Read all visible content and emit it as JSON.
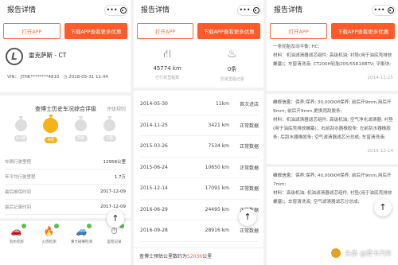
{
  "screen1": {
    "title": "报告详情",
    "menu_dots": "•••",
    "open_app": "打开APP",
    "download_app": "下载APP查看更多优惠",
    "car_name": "雷克萨斯 - CT",
    "vin": "VIN： JTHK********4810",
    "date": "2018-05-31 11:44",
    "grade_title": "查博士历史车况综合评级",
    "grade_link": "评级规则",
    "grades": [
      {
        "label": "A+级",
        "active": false
      },
      {
        "label": "A级",
        "active": true
      },
      {
        "label": "B级",
        "active": false
      },
      {
        "label": "C级",
        "active": false
      }
    ],
    "stats": [
      {
        "key": "车辆行驶里程",
        "value": "12958公里"
      },
      {
        "key": "年平均行驶里程",
        "value": "1.7万"
      },
      {
        "key": "最后维保时间",
        "value": "2017-12-09"
      },
      {
        "key": "最后记录时间",
        "value": "2017-12-09"
      }
    ],
    "icons": [
      {
        "label": "泡水检测",
        "glyph": "🚗"
      },
      {
        "label": "火烧检测",
        "glyph": "🔥"
      },
      {
        "label": "重大碰撞检测",
        "glyph": "🚙"
      },
      {
        "label": "里程记录",
        "glyph": "⏱"
      }
    ],
    "fab": "↑"
  },
  "screen2": {
    "title": "报告详情",
    "menu_dots": "•••",
    "open_app": "打开APP",
    "download_app": "下载APP查看更多优惠",
    "kpi_mileage": "45774 km",
    "kpi_mileage_label": "已行驶里程数",
    "kpi_count": "0条",
    "kpi_count_label": "异常里程记录",
    "records": [
      {
        "date": "2014-05-30",
        "km": "11km",
        "type": "首次进店"
      },
      {
        "date": "2014-11-25",
        "km": "3421 km",
        "type": "正常数据"
      },
      {
        "date": "2015-03-26",
        "km": "7534 km",
        "type": "正常数据"
      },
      {
        "date": "2015-06-24",
        "km": "10650 km",
        "type": "正常数据"
      },
      {
        "date": "2015-12-14",
        "km": "17091 km",
        "type": "正常数据"
      },
      {
        "date": "2016-06-29",
        "km": "24495 km",
        "type": "正常数据"
      },
      {
        "date": "2016-09-28",
        "km": "28916 km",
        "type": "正常数据"
      }
    ],
    "summary_prefix": "查博士预估公里数约为",
    "summary_value": "52036",
    "summary_suffix": "公里",
    "fab": "↑"
  },
  "screen3": {
    "title": "报告详情",
    "menu_dots": "•••",
    "open_app": "打开APP",
    "download_app": "下载APP查看更多优惠",
    "block1_text": "一条轮胎及动平衡; HC;",
    "block1_materials": "材料：机油滤清器滤芯组件; 高级机油; 衬垫(用于油底壳排放螺塞)；车窗清洗液; CT200H轮胎205/55R16BTV; 平衡块;",
    "block1_date": "2014-11-25",
    "block2_label": "维修信息：",
    "block2_text": "保养;保养; 30,000KM保养; 前后开9mm,用后开9mm; 前后开9mm,更换雨刮胶条;",
    "block2_materials": "材料：机油滤清器滤芯组件; 高级机油; 空气净化滤清器; 衬垫(用于油底壳排放螺塞)；右前刮水器橡胶条; 左前刮水器橡胶条; 后刮水器橡胶条; 空气滤清器滤芯分总成; 车窗清洗液;",
    "block2_date": "2015-12-14",
    "block3_label": "维修信息：",
    "block3_text": "保养;保养; 40,000KM保养; 前后开9mm,用后开7mm;",
    "block3_materials": "材料：高级机油; 机油滤清器滤芯组件; 衬垫(用于油底壳排放螺塞)；车窗清洗液; 空气滤清器滤芯分总成;",
    "watermark": "头条 @爱卡汽车",
    "fab": "↑"
  },
  "colors": {
    "accent": "#ff5a2a",
    "gold": "#f6b21b",
    "check": "#5bbf4a"
  }
}
